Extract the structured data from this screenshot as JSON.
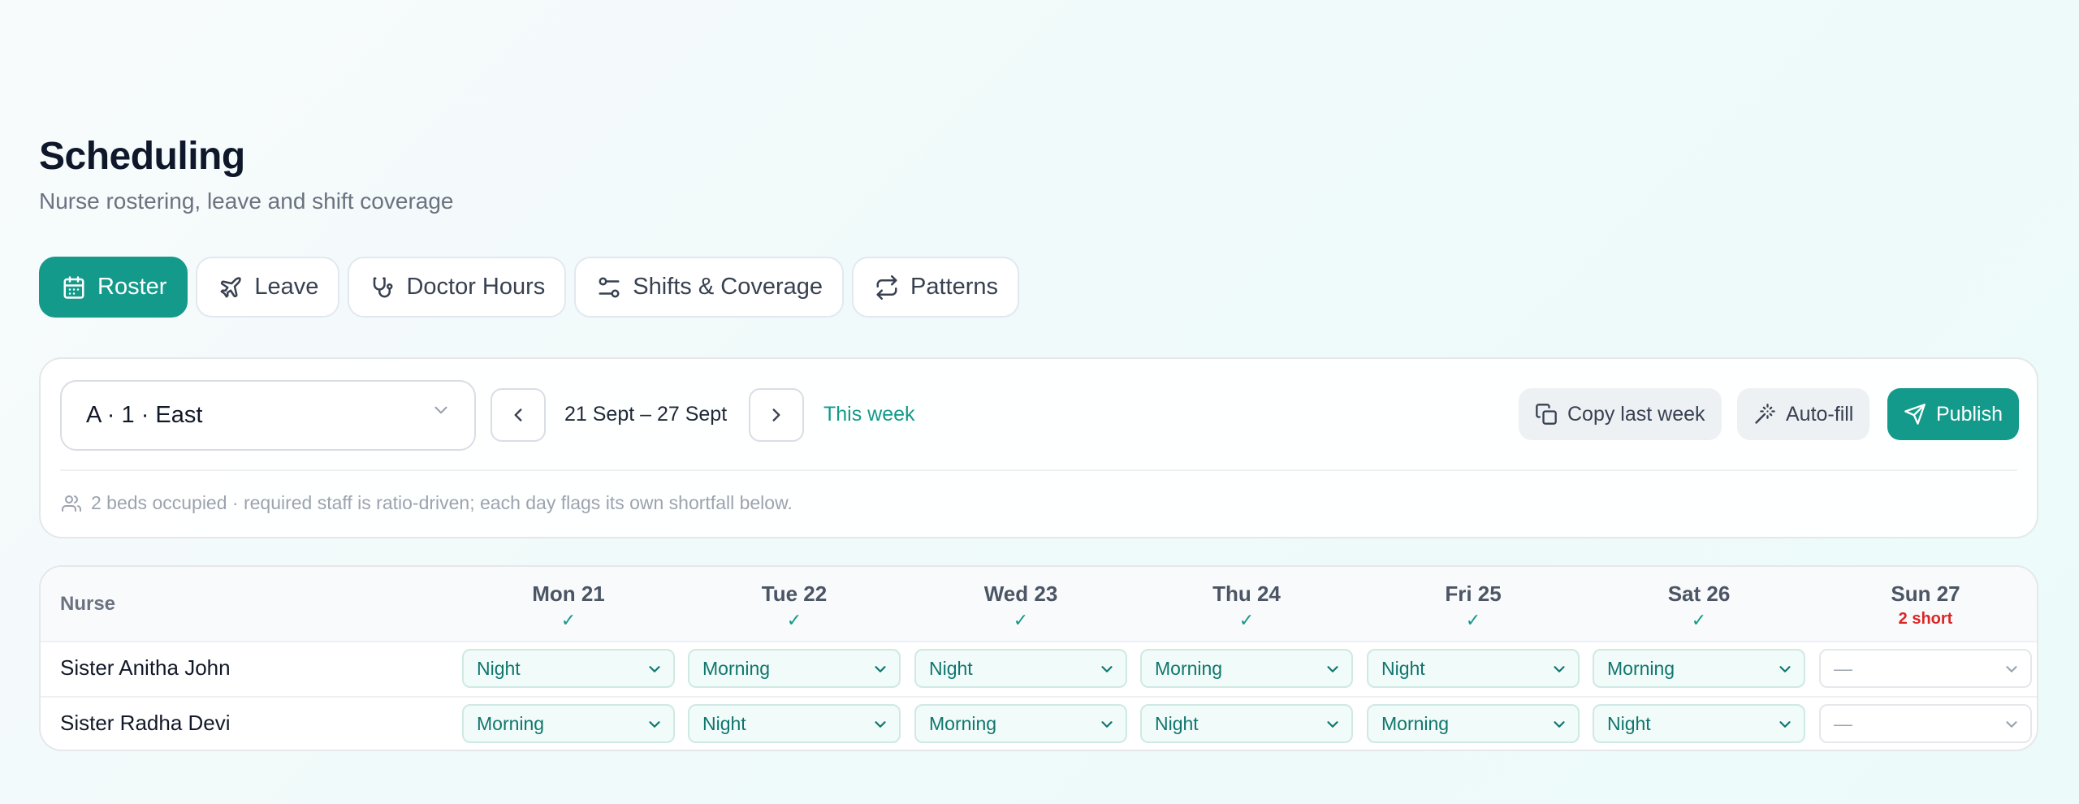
{
  "header": {
    "title": "Scheduling",
    "subtitle": "Nurse rostering, leave and shift coverage"
  },
  "tabs": [
    {
      "label": "Roster",
      "icon": "calendar-icon",
      "active": true
    },
    {
      "label": "Leave",
      "icon": "plane-icon",
      "active": false
    },
    {
      "label": "Doctor Hours",
      "icon": "stethoscope-icon",
      "active": false
    },
    {
      "label": "Shifts & Coverage",
      "icon": "sliders-icon",
      "active": false
    },
    {
      "label": "Patterns",
      "icon": "repeat-icon",
      "active": false
    }
  ],
  "toolbar": {
    "ward": "A · 1 · East",
    "range": "21 Sept – 27 Sept",
    "this_week": "This week",
    "copy_last_week": "Copy last week",
    "auto_fill": "Auto-fill",
    "publish": "Publish",
    "note": "2 beds occupied · required staff is ratio-driven; each day flags its own shortfall below."
  },
  "colors": {
    "accent": "#139a8a",
    "danger": "#dc2626"
  },
  "grid": {
    "nurse_header": "Nurse",
    "days": [
      {
        "label": "Mon 21",
        "status": "✓"
      },
      {
        "label": "Tue 22",
        "status": "✓"
      },
      {
        "label": "Wed 23",
        "status": "✓"
      },
      {
        "label": "Thu 24",
        "status": "✓"
      },
      {
        "label": "Fri 25",
        "status": "✓"
      },
      {
        "label": "Sat 26",
        "status": "✓"
      },
      {
        "label": "Sun 27",
        "status": "2 short"
      }
    ],
    "rows": [
      {
        "nurse": "Sister Anitha John",
        "shifts": [
          "Night",
          "Morning",
          "Night",
          "Morning",
          "Night",
          "Morning",
          "—"
        ]
      },
      {
        "nurse": "Sister Radha Devi",
        "shifts": [
          "Morning",
          "Night",
          "Morning",
          "Night",
          "Morning",
          "Night",
          "—"
        ]
      }
    ]
  }
}
